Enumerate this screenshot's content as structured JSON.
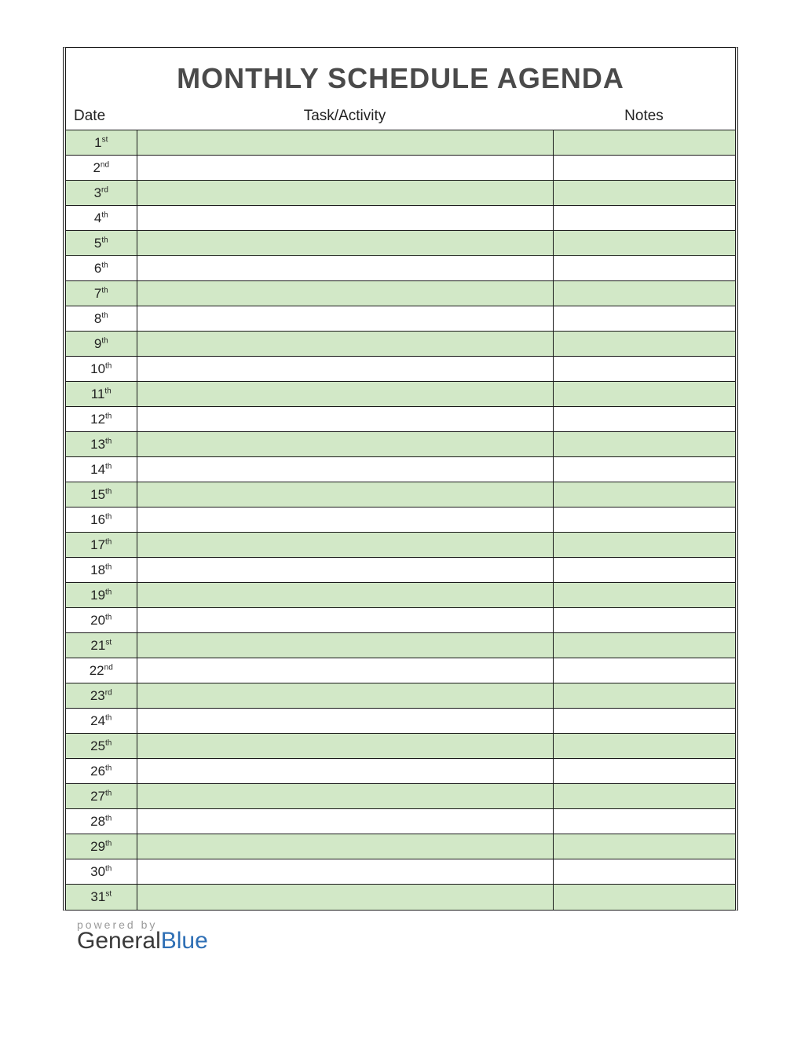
{
  "title": "MONTHLY SCHEDULE AGENDA",
  "columns": {
    "date": "Date",
    "task": "Task/Activity",
    "notes": "Notes"
  },
  "rows": [
    {
      "num": "1",
      "suffix": "st",
      "task": "",
      "notes": ""
    },
    {
      "num": "2",
      "suffix": "nd",
      "task": "",
      "notes": ""
    },
    {
      "num": "3",
      "suffix": "rd",
      "task": "",
      "notes": ""
    },
    {
      "num": "4",
      "suffix": "th",
      "task": "",
      "notes": ""
    },
    {
      "num": "5",
      "suffix": "th",
      "task": "",
      "notes": ""
    },
    {
      "num": "6",
      "suffix": "th",
      "task": "",
      "notes": ""
    },
    {
      "num": "7",
      "suffix": "th",
      "task": "",
      "notes": ""
    },
    {
      "num": "8",
      "suffix": "th",
      "task": "",
      "notes": ""
    },
    {
      "num": "9",
      "suffix": "th",
      "task": "",
      "notes": ""
    },
    {
      "num": "10",
      "suffix": "th",
      "task": "",
      "notes": ""
    },
    {
      "num": "11",
      "suffix": "th",
      "task": "",
      "notes": ""
    },
    {
      "num": "12",
      "suffix": "th",
      "task": "",
      "notes": ""
    },
    {
      "num": "13",
      "suffix": "th",
      "task": "",
      "notes": ""
    },
    {
      "num": "14",
      "suffix": "th",
      "task": "",
      "notes": ""
    },
    {
      "num": "15",
      "suffix": "th",
      "task": "",
      "notes": ""
    },
    {
      "num": "16",
      "suffix": "th",
      "task": "",
      "notes": ""
    },
    {
      "num": "17",
      "suffix": "th",
      "task": "",
      "notes": ""
    },
    {
      "num": "18",
      "suffix": "th",
      "task": "",
      "notes": ""
    },
    {
      "num": "19",
      "suffix": "th",
      "task": "",
      "notes": ""
    },
    {
      "num": "20",
      "suffix": "th",
      "task": "",
      "notes": ""
    },
    {
      "num": "21",
      "suffix": "st",
      "task": "",
      "notes": ""
    },
    {
      "num": "22",
      "suffix": "nd",
      "task": "",
      "notes": ""
    },
    {
      "num": "23",
      "suffix": "rd",
      "task": "",
      "notes": ""
    },
    {
      "num": "24",
      "suffix": "th",
      "task": "",
      "notes": ""
    },
    {
      "num": "25",
      "suffix": "th",
      "task": "",
      "notes": ""
    },
    {
      "num": "26",
      "suffix": "th",
      "task": "",
      "notes": ""
    },
    {
      "num": "27",
      "suffix": "th",
      "task": "",
      "notes": ""
    },
    {
      "num": "28",
      "suffix": "th",
      "task": "",
      "notes": ""
    },
    {
      "num": "29",
      "suffix": "th",
      "task": "",
      "notes": ""
    },
    {
      "num": "30",
      "suffix": "th",
      "task": "",
      "notes": ""
    },
    {
      "num": "31",
      "suffix": "st",
      "task": "",
      "notes": ""
    }
  ],
  "footer": {
    "powered": "powered by",
    "brand_a": "General",
    "brand_b": "Blue"
  }
}
